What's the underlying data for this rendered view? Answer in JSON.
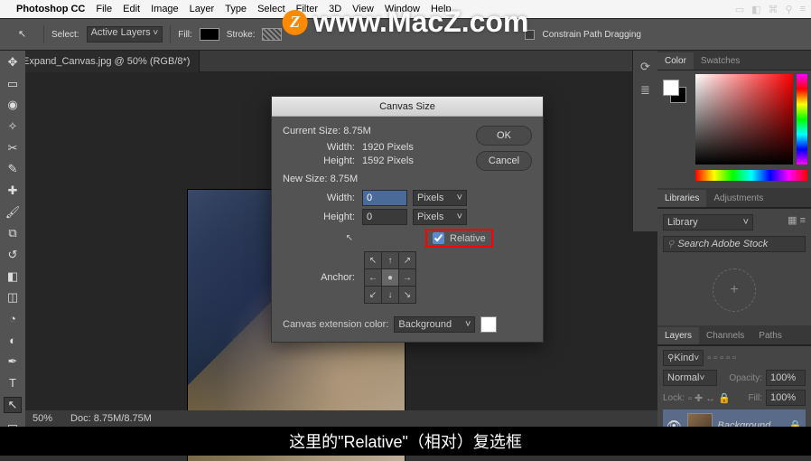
{
  "menubar": {
    "app": "Photoshop CC",
    "items": [
      "File",
      "Edit",
      "Image",
      "Layer",
      "Type",
      "Select",
      "Filter",
      "3D",
      "View",
      "Window",
      "Help"
    ]
  },
  "options": {
    "select_label": "Select:",
    "select_val": "Active Layers",
    "fill_label": "Fill:",
    "stroke_label": "Stroke:",
    "constrain": "Constrain Path Dragging"
  },
  "tab": {
    "title": "Expand_Canvas.jpg @ 50% (RGB/8*)"
  },
  "dialog": {
    "title": "Canvas Size",
    "ok": "OK",
    "cancel": "Cancel",
    "current_label": "Current Size: 8.75M",
    "cur_width_label": "Width:",
    "cur_width": "1920 Pixels",
    "cur_height_label": "Height:",
    "cur_height": "1592 Pixels",
    "new_label": "New Size: 8.75M",
    "new_width_label": "Width:",
    "new_width": "0",
    "new_height_label": "Height:",
    "new_height": "0",
    "unit": "Pixels",
    "relative": "Relative",
    "anchor_label": "Anchor:",
    "ext_label": "Canvas extension color:",
    "ext_val": "Background"
  },
  "color_panel": {
    "tabs": [
      "Color",
      "Swatches"
    ]
  },
  "lib_panel": {
    "tabs": [
      "Libraries",
      "Adjustments"
    ],
    "select": "Library",
    "search": "Search Adobe Stock"
  },
  "layers_panel": {
    "tabs": [
      "Layers",
      "Channels",
      "Paths"
    ],
    "kind": "Kind",
    "blend": "Normal",
    "opacity_label": "Opacity:",
    "opacity": "100%",
    "lock_label": "Lock:",
    "fill_label": "Fill:",
    "fill": "100%",
    "layer_name": "Background"
  },
  "watermark": "www.MacZ.com",
  "subtitle": "这里的\"Relative\"（相对）复选框",
  "status": {
    "zoom": "50%",
    "doc": "Doc: 8.75M/8.75M"
  }
}
